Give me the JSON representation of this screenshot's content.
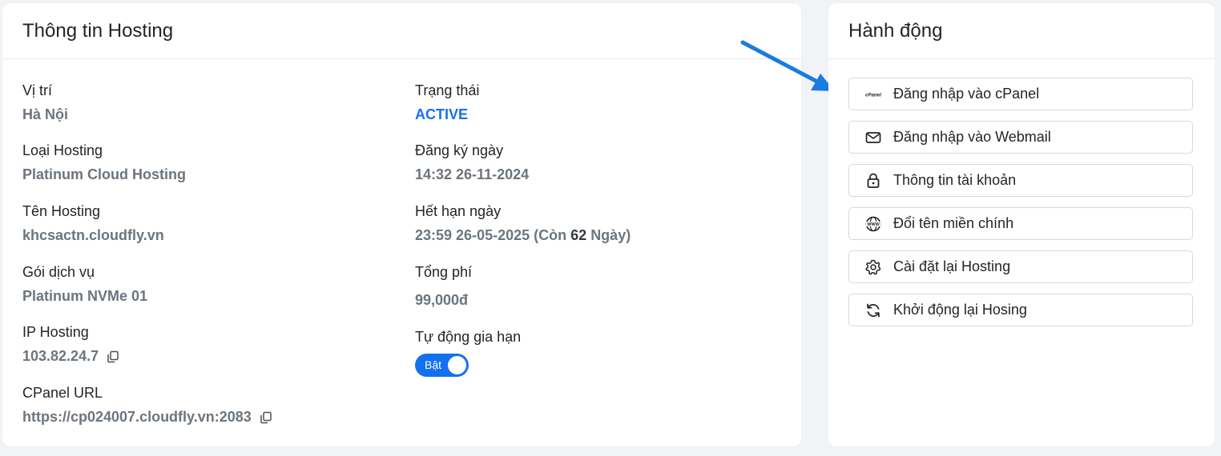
{
  "info": {
    "title": "Thông tin Hosting",
    "location": {
      "label": "Vị trí",
      "value": "Hà Nội"
    },
    "hosting_type": {
      "label": "Loại Hosting",
      "value": "Platinum Cloud Hosting"
    },
    "hosting_name": {
      "label": "Tên Hosting",
      "value": "khcsactn.cloudfly.vn"
    },
    "plan": {
      "label": "Gói dịch vụ",
      "value": "Platinum NVMe 01"
    },
    "ip": {
      "label": "IP Hosting",
      "value": "103.82.24.7"
    },
    "cpanel_url": {
      "label": "CPanel URL",
      "value": "https://cp024007.cloudfly.vn:2083"
    },
    "status": {
      "label": "Trạng thái",
      "value": "ACTIVE"
    },
    "registered": {
      "label": "Đăng ký ngày",
      "value": "14:32 26-11-2024"
    },
    "expires": {
      "label": "Hết hạn ngày",
      "date": "23:59 26-05-2025",
      "remaining_prefix": "(Còn",
      "remaining_days": "62",
      "remaining_suffix": "Ngày)"
    },
    "total_fee": {
      "label": "Tổng phí",
      "value": "99,000đ"
    },
    "auto_renew": {
      "label": "Tự động gia hạn",
      "toggle_label": "Bật",
      "enabled": true
    }
  },
  "actions": {
    "title": "Hành động",
    "buttons": [
      {
        "label": "Đăng nhập vào cPanel",
        "icon": "cpanel-icon"
      },
      {
        "label": "Đăng nhập vào Webmail",
        "icon": "mail-icon"
      },
      {
        "label": "Thông tin tài khoản",
        "icon": "lock-icon"
      },
      {
        "label": "Đổi tên miền chính",
        "icon": "www-globe-icon"
      },
      {
        "label": "Cài đặt lại Hosting",
        "icon": "gear-icon"
      },
      {
        "label": "Khởi động lại Hosing",
        "icon": "refresh-icon"
      }
    ]
  },
  "colors": {
    "accent": "#1570ef",
    "muted": "#6c757d",
    "arrow": "#1a7be0"
  }
}
